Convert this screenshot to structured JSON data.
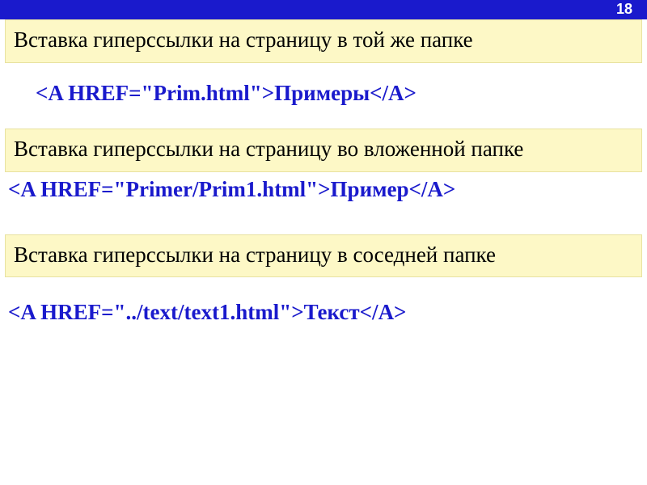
{
  "page_number": "18",
  "sections": [
    {
      "heading": "Вставка гиперссылки на страницу в той же папке",
      "code": "<A HREF=\"Prim.html\">Примеры</A>"
    },
    {
      "heading": "Вставка гиперссылки на страницу во вложенной папке",
      "code": "<A HREF=\"Primer/Prim1.html\">Пример</A>"
    },
    {
      "heading": "Вставка гиперссылки на страницу в соседней папке",
      "code": "<A HREF=\"../text/text1.html\">Текст</A>"
    }
  ]
}
